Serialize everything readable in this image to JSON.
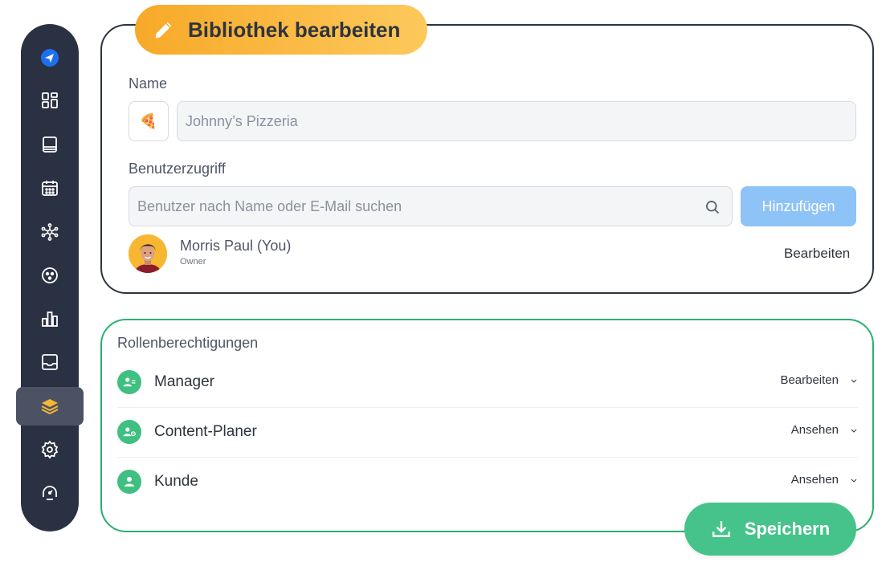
{
  "sidebar": {
    "items": [
      {
        "icon": "send-logo-icon"
      },
      {
        "icon": "dashboard-icon"
      },
      {
        "icon": "library-icon"
      },
      {
        "icon": "calendar-icon"
      },
      {
        "icon": "network-icon"
      },
      {
        "icon": "emoji-icon"
      },
      {
        "icon": "analytics-icon"
      },
      {
        "icon": "inbox-icon"
      },
      {
        "icon": "layers-icon",
        "active": true
      },
      {
        "icon": "settings-icon"
      },
      {
        "icon": "support-icon"
      }
    ]
  },
  "edit_library": {
    "title": "Bibliothek bearbeiten",
    "name_label": "Name",
    "name_emoji": "🍕",
    "name_value": "Johnny’s Pizzeria",
    "access_label": "Benutzerzugriff",
    "search_placeholder": "Benutzer nach Name oder E-Mail suchen",
    "add_button": "Hinzufügen",
    "user": {
      "name": "Morris Paul (You)",
      "role": "Owner",
      "action": "Bearbeiten"
    }
  },
  "roles": {
    "heading": "Rollenberechtigungen",
    "items": [
      {
        "name": "Manager",
        "permission": "Bearbeiten"
      },
      {
        "name": "Content-Planer",
        "permission": "Ansehen"
      },
      {
        "name": "Kunde",
        "permission": "Ansehen"
      }
    ]
  },
  "save_button": "Speichern",
  "colors": {
    "sidebar_bg": "#2a3142",
    "title_gradient_start": "#f7a928",
    "title_gradient_end": "#fdc95c",
    "role_green": "#3fbf80",
    "save_green": "#46c38a",
    "add_button_blue": "#8ec3f8"
  }
}
